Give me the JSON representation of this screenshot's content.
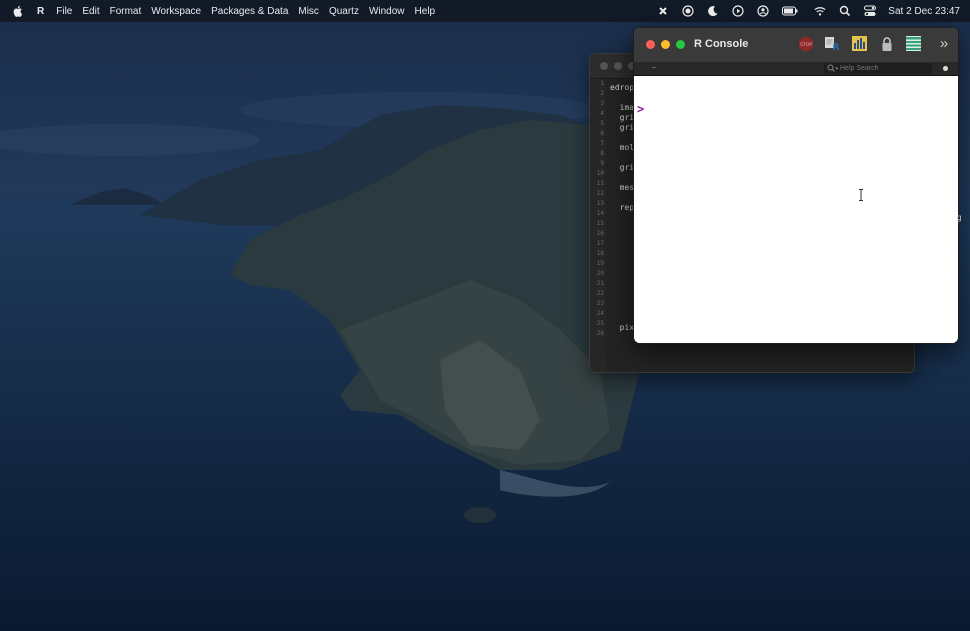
{
  "menubar": {
    "app_name": "R",
    "menus": [
      "File",
      "Edit",
      "Format",
      "Workspace",
      "Packages & Data",
      "Misc",
      "Quartz",
      "Window",
      "Help"
    ],
    "clock": "Sat 2 Dec  23:47",
    "status_icons": [
      "close-x-icon",
      "record-icon",
      "moon-icon",
      "play-icon",
      "user-icon",
      "battery-icon",
      "wifi-icon",
      "search-icon",
      "control-center-icon"
    ]
  },
  "editor": {
    "line_numbers": [
      "1",
      "2",
      "3",
      "4",
      "5",
      "6",
      "7",
      "8",
      "9",
      "10",
      "11",
      "12",
      "13",
      "14",
      "15",
      "16",
      "17",
      "18",
      "19",
      "20",
      "21",
      "22",
      "23",
      "24",
      "25",
      "26"
    ],
    "code_lines": [
      "edrop",
      "",
      "  ima",
      "  gri",
      "  gri",
      "",
      "  mol",
      "",
      "  gri",
      "",
      "  mes",
      "",
      "  rep",
      "",
      "",
      "",
      "",
      "",
      "",
      "",
      "",
      "",
      "",
      "",
      "  pixels['y'] <- grid_dim['y'] - pixels['y']",
      ""
    ]
  },
  "console": {
    "title": "R Console",
    "path": "~",
    "search_placeholder": "Help Search",
    "prompt": ">",
    "toolbar_more": "»"
  },
  "edge_text": "g",
  "colors": {
    "prompt": "#8a1a9b",
    "close": "#ff5f57",
    "minimize": "#febc2e",
    "maximize": "#28c840"
  }
}
